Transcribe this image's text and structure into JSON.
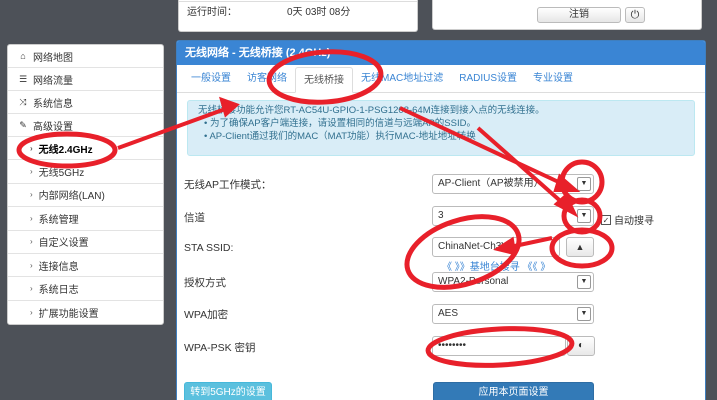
{
  "status": {
    "label": "运行时间：",
    "value": "0天 03时 08分"
  },
  "topbar": {
    "logout_label": "注销",
    "power_glyph": "⏻"
  },
  "sidebar": {
    "items": [
      {
        "label": "网络地图",
        "icon": "home-icon",
        "glyph": "⌂"
      },
      {
        "label": "网络流量",
        "icon": "list-icon",
        "glyph": "☰"
      },
      {
        "label": "系统信息",
        "icon": "shuffle-icon",
        "glyph": "⤨"
      },
      {
        "label": "高级设置",
        "icon": "wrench-icon",
        "glyph": "✎"
      }
    ],
    "subitems": [
      {
        "label": "无线2.4GHz"
      },
      {
        "label": "无线5GHz"
      },
      {
        "label": "内部网络(LAN)"
      },
      {
        "label": "系统管理"
      },
      {
        "label": "自定义设置"
      },
      {
        "label": "连接信息"
      },
      {
        "label": "系统日志"
      },
      {
        "label": "扩展功能设置"
      }
    ],
    "chevron": "›"
  },
  "panel": {
    "title": "无线网络 - 无线桥接 (2.4GHz)",
    "tabs": [
      "一般设置",
      "访客网络",
      "无线桥接",
      "无线MAC地址过滤",
      "RADIUS设置",
      "专业设置"
    ],
    "info_main": "无线桥接功能允许您RT-AC54U-GPIO-1-PSG1208-64M连接到接入点的无线连接。",
    "info_items": [
      "• 为了确保AP客户端连接，请设置相同的信道与远端AP的SSID。",
      "• AP-Client通过我们的MAC（MAT功能）执行MAC-地址地址转换"
    ]
  },
  "form": {
    "mode_label": "无线AP工作模式：",
    "mode_value": "AP-Client（AP被禁用）",
    "channel_label": "信道",
    "channel_value": "3",
    "auto_scan_label": "自动搜寻",
    "ssid_label": "STA SSID:",
    "ssid_value": "ChinaNet-Ch3W",
    "scan_label": "《 》》基地台搜寻 《《 》",
    "auth_label": "授权方式",
    "auth_value": "WPA2-Personal",
    "wpa_label": "WPA加密",
    "wpa_value": "AES",
    "psk_label": "WPA-PSK 密钥",
    "psk_value": "••••••••",
    "dropdown_glyph": "▼",
    "up_glyph": "▲",
    "check_glyph": "✓",
    "eye_glyph": "◐"
  },
  "buttons": {
    "to5g": "转到5GHz的设置",
    "apply": "应用本页面设置"
  },
  "colors": {
    "annotation": "#e8202a",
    "accent": "#3a85d4"
  }
}
